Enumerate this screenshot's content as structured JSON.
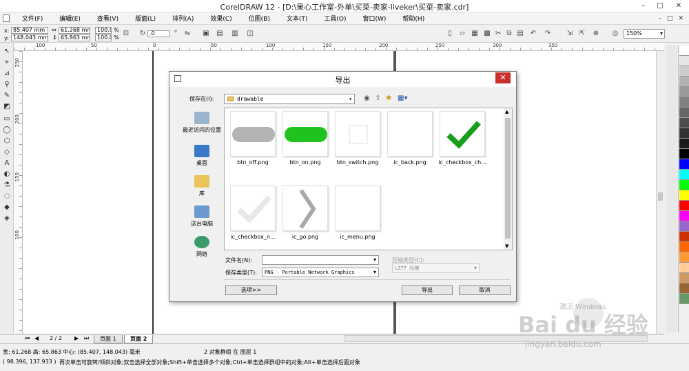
{
  "window": {
    "title": "CorelDRAW 12 - [D:\\果心工作室-外单\\买菜-卖家-liveker\\买菜-卖家.cdr]",
    "controls": [
      "–",
      "□",
      "✕"
    ]
  },
  "menubar": {
    "items": [
      "文件(F)",
      "编辑(E)",
      "查看(V)",
      "版面(L)",
      "排列(A)",
      "效果(C)",
      "位图(B)",
      "文本(T)",
      "工具(O)",
      "窗口(W)",
      "帮助(H)"
    ],
    "mdi_controls": [
      "–",
      "□",
      "✕"
    ]
  },
  "propbar": {
    "x_label": "x:",
    "x_value": "85.407 mm",
    "y_label": "y:",
    "y_value": "148.043 mm",
    "w_value": "61.268 mm",
    "h_value": "65.863 mm",
    "scale_x": "100.0",
    "scale_y": "100.0",
    "pct": "%",
    "rotation": ".0",
    "zoom": "150%"
  },
  "ruler": {
    "top_ticks": [
      "100",
      "50",
      "0",
      "50",
      "100",
      "150",
      "200",
      "250",
      "300",
      "350"
    ],
    "left_ticks": [
      "250",
      "200",
      "150",
      "100"
    ]
  },
  "palette": [
    "#ffffff",
    "#e6e6e6",
    "#cccccc",
    "#b3b3b3",
    "#999999",
    "#808080",
    "#666666",
    "#4d4d4d",
    "#333333",
    "#1a1a1a",
    "#000000",
    "#0000ff",
    "#00ffff",
    "#00ff00",
    "#ffff00",
    "#ff0000",
    "#ff00ff",
    "#9966cc",
    "#cc3300",
    "#ff6600",
    "#ff9933",
    "#ffcc99",
    "#cc9966",
    "#996633",
    "#669966"
  ],
  "pagetabs": {
    "page_count": "2 / 2",
    "tabs": [
      "页面 1",
      "页面 2"
    ]
  },
  "status": {
    "line1_left": "宽: 61.268 高: 65.863 中心: (85.407, 148.043) 毫米",
    "line1_mid": "2 对象群组 在 图层 1",
    "line2_left": "( 98.396, 137.933 )",
    "line2_hint": "再次单击可旋转/倾斜对象;双击选择全部对象;Shift+单击选择多个对象;Ctrl+单击选择群组中的对象;Alt+单击选择后面对象"
  },
  "dialog": {
    "title": "导出",
    "save_in_label": "保存在(I):",
    "save_in_value": "drawable",
    "places": [
      "最近访问的位置",
      "桌面",
      "库",
      "这台电脑",
      "网络"
    ],
    "files": [
      {
        "name": "btn_off.png",
        "kind": "pill",
        "color": "#b3b3b3"
      },
      {
        "name": "btn_on.png",
        "kind": "pill",
        "color": "#1ec31e"
      },
      {
        "name": "btn_switch.png",
        "kind": "square",
        "color": "#ffffff"
      },
      {
        "name": "ic_back.png",
        "kind": "blank",
        "color": "#ffffff"
      },
      {
        "name": "ic_checkbox_ch...",
        "kind": "check",
        "color": "#1a9e1a"
      },
      {
        "name": "ic_checkbox_n...",
        "kind": "check",
        "color": "#e8e8e8"
      },
      {
        "name": "ic_go.png",
        "kind": "chevron",
        "color": "#a8a8a8"
      },
      {
        "name": "ic_menu.png",
        "kind": "blank",
        "color": "#ffffff"
      }
    ],
    "filename_label": "文件名(N):",
    "filename_value": "",
    "filetype_label": "保存类型(T):",
    "filetype_value": "PNG - Portable Network Graphics",
    "compression_label": "压缩类型(C):",
    "compression_value": "LZ77 压缩",
    "options_button": "选项>>",
    "export_button": "导出",
    "cancel_button": "取消"
  },
  "watermark": {
    "logo_text": "Bai du 经验",
    "sub_text": "jingyan.baidu.com",
    "windows_text": "激活 Windows"
  }
}
